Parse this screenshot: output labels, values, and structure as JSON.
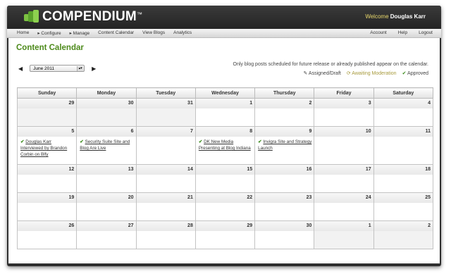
{
  "header": {
    "brand": "COMPENDIUM",
    "brand_tm": "™",
    "welcome_prefix": "Welcome",
    "welcome_user": "Douglas Karr"
  },
  "nav": {
    "left": [
      "Home",
      "▸ Configure",
      "▸ Manage",
      "Content Calendar",
      "View Blogs",
      "Analytics"
    ],
    "right": [
      "Account",
      "Help",
      "Logout"
    ]
  },
  "page": {
    "title": "Content Calendar",
    "month_select": "June 2011",
    "info": "Only blog posts scheduled for future release or already published appear on the calendar.",
    "legend": {
      "draft": "Assigned/Draft",
      "moderation": "Awaiting Moderation",
      "approved": "Approved"
    }
  },
  "calendar": {
    "days": [
      "Sunday",
      "Monday",
      "Tuesday",
      "Wednesday",
      "Thursday",
      "Friday",
      "Saturday"
    ],
    "weeks": [
      [
        "29",
        "30",
        "31",
        "1",
        "2",
        "3",
        "4"
      ],
      [
        "5",
        "6",
        "7",
        "8",
        "9",
        "10",
        "11"
      ],
      [
        "12",
        "13",
        "14",
        "15",
        "16",
        "17",
        "18"
      ],
      [
        "19",
        "20",
        "21",
        "22",
        "23",
        "24",
        "25"
      ],
      [
        "26",
        "27",
        "28",
        "29",
        "30",
        "1",
        "2"
      ]
    ],
    "posts": {
      "sun5": "Douglas Karr Interviewed by Brandon Corbin on Blfy",
      "mon6": "Security Suite Site and Blog Are Live",
      "wed8": "DK New Media Presenting at Blog Indiana",
      "thu9": "Invigra Site and Strategy Launch"
    }
  },
  "colors": {
    "accent_green": "#4d8a1b",
    "header_bg": "#2e2e2e",
    "welcome": "#e9d86c"
  }
}
